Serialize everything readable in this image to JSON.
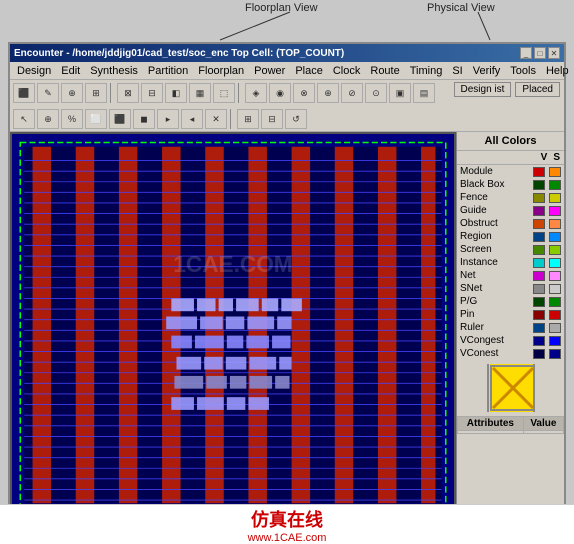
{
  "annotations": {
    "floorplan_label": "Floorplan View",
    "physical_label": "Physical View"
  },
  "window": {
    "title": "Encounter - /home/jddjig01/cad_test/soc_enc  Top Cell: (TOP_COUNT)",
    "title_short": "Encounter - /home/jddjig01/cad_test/soc_enc  Top Cell: (TOP_COUNT)"
  },
  "menu": {
    "items": [
      "Design",
      "Edit",
      "Synthesis",
      "Partition",
      "Floorplan",
      "Power",
      "Place",
      "Clock",
      "Route",
      "Timing",
      "SI",
      "Verify",
      "Tools",
      "Help"
    ]
  },
  "toolbar": {
    "design_ist": "Design ist",
    "placed": "Placed"
  },
  "right_panel": {
    "title": "All Colors",
    "vs_v": "V",
    "vs_s": "S",
    "rows": [
      {
        "label": "Module",
        "color_v": "#cc0000",
        "color_s": "#ff8800"
      },
      {
        "label": "Black Box",
        "color_v": "#008800",
        "color_s": "#00cc00"
      },
      {
        "label": "Fence",
        "color_v": "#888800",
        "color_s": "#cccc00"
      },
      {
        "label": "Guide",
        "color_v": "#880088",
        "color_s": "#ff00ff"
      },
      {
        "label": "Obstruct",
        "color_v": "#cc4400",
        "color_s": "#ff8844"
      },
      {
        "label": "Region",
        "color_v": "#004488",
        "color_s": "#0088ff"
      },
      {
        "label": "Screen",
        "color_v": "#448800",
        "color_s": "#88cc00"
      },
      {
        "label": "Instance",
        "color_v": "#00cccc",
        "color_s": "#00ffff"
      },
      {
        "label": "Net",
        "color_v": "#cc00cc",
        "color_s": "#ff88ff"
      },
      {
        "label": "SNet",
        "color_v": "#888888",
        "color_s": "#cccccc"
      },
      {
        "label": "P/G",
        "color_v": "#004400",
        "color_s": "#008800"
      },
      {
        "label": "Pin",
        "color_v": "#880000",
        "color_s": "#cc0000"
      },
      {
        "label": "Ruler",
        "color_v": "#004488",
        "color_s": "#aaaaaa"
      },
      {
        "label": "VCongest",
        "color_v": "#000088",
        "color_s": "#0000ff"
      },
      {
        "label": "VConest",
        "color_v": "#000044",
        "color_s": "#000088"
      }
    ],
    "attr_headers": [
      "Attributes",
      "Value"
    ]
  },
  "watermark": {
    "chinese": "仿真在线",
    "url": "www.1CAE.com"
  },
  "canvas_watermark": "1CAE.COM",
  "status": ""
}
